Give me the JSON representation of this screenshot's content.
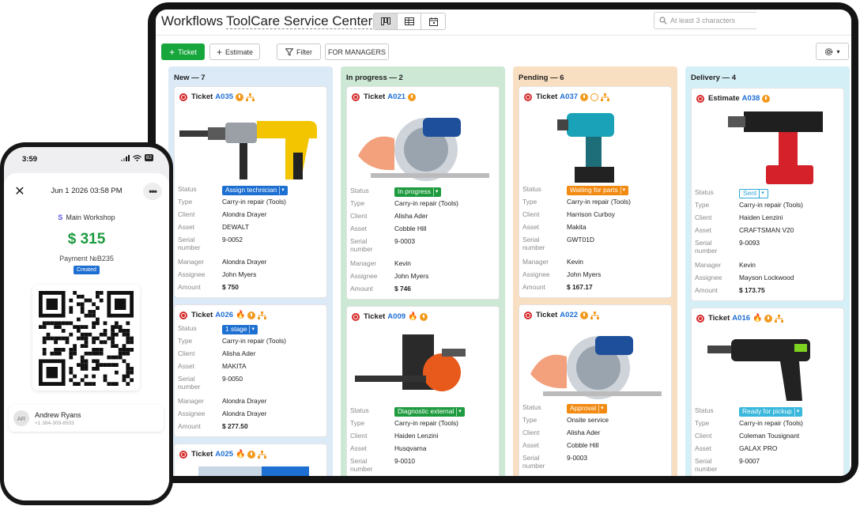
{
  "header": {
    "title": "Workflows",
    "org_name": "ToolCare Service Center",
    "search_placeholder": "At least 3 characters"
  },
  "toolbar": {
    "ticket_label": "Ticket",
    "estimate_label": "Estimate",
    "filter_label": "Filter",
    "managers_label": "FOR MANAGERS"
  },
  "field_labels": {
    "status": "Status",
    "type": "Type",
    "client": "Client",
    "asset": "Asset",
    "serial": "Serial number",
    "manager": "Manager",
    "assignee": "Assignee",
    "amount": "Amount"
  },
  "columns": {
    "new": {
      "title": "New — 7",
      "cards": [
        {
          "kind": "Ticket",
          "number": "A035",
          "status": "Assign technician",
          "type": "Carry-in repair (Tools)",
          "client": "Alondra Drayer",
          "asset": "DEWALT",
          "serial": "9-0052",
          "manager": "Alondra Drayer",
          "assignee": "John Myers",
          "amount": "$ 750"
        },
        {
          "kind": "Ticket",
          "number": "A026",
          "status": "1 stage",
          "type": "Carry-in repair (Tools)",
          "client": "Alisha Ader",
          "asset": "MAKITA",
          "serial": "9-0050",
          "manager": "Alondra Drayer",
          "assignee": "Alondra Drayer",
          "amount": "$ 277.50"
        },
        {
          "kind": "Ticket",
          "number": "A025"
        }
      ]
    },
    "progress": {
      "title": "In progress — 2",
      "cards": [
        {
          "kind": "Ticket",
          "number": "A021",
          "status": "In progress",
          "type": "Carry-in repair (Tools)",
          "client": "Alisha Ader",
          "asset": "Cobble Hill",
          "serial": "9-0003",
          "manager": "Kevin",
          "assignee": "John Myers",
          "amount": "$ 746"
        },
        {
          "kind": "Ticket",
          "number": "A009",
          "status": "Diagnostic external",
          "type": "Carry-in repair (Tools)",
          "client": "Haiden Lenzini",
          "asset": "Husqvarna",
          "serial": "9-0010"
        }
      ]
    },
    "pending": {
      "title": "Pending — 6",
      "cards": [
        {
          "kind": "Ticket",
          "number": "A037",
          "status": "Waiting for parts",
          "type": "Carry-in repair (Tools)",
          "client": "Harrison Curboy",
          "asset": "Makita",
          "serial": "GWT01D",
          "manager": "Kevin",
          "assignee": "John Myers",
          "amount": "$ 167.17"
        },
        {
          "kind": "Ticket",
          "number": "A022",
          "status": "Approval",
          "type": "Onsite service",
          "client": "Alisha Ader",
          "asset": "Cobble Hill",
          "serial": "9-0003"
        }
      ]
    },
    "delivery": {
      "title": "Delivery — 4",
      "cards": [
        {
          "kind": "Estimate",
          "number": "A038",
          "status": "Sent",
          "type": "Carry-in repair (Tools)",
          "client": "Haiden Lenzini",
          "asset": "CRAFTSMAN V20",
          "serial": "9-0093",
          "manager": "Kevin",
          "assignee": "Mayson Lockwood",
          "amount": "$ 173.75"
        },
        {
          "kind": "Ticket",
          "number": "A016",
          "status": "Ready for pickup",
          "type": "Carry-in repair (Tools)",
          "client": "Coleman Tousignant",
          "asset": "GALAX PRO",
          "serial": "9-0007"
        }
      ]
    }
  },
  "phone": {
    "time": "3:59",
    "battery": "82",
    "date": "Jun 1 2026 03:58 PM",
    "workshop": "Main Workshop",
    "amount": "$ 315",
    "payment_number": "Payment №B235",
    "status": "Created",
    "contact_name": "Andrew Ryans",
    "contact_phone": "+1 384-309-8503",
    "contact_initials": "AR"
  },
  "colors": {
    "primary_green": "#17a63c",
    "link_blue": "#1f6fd6",
    "new_col": "#dceaf8",
    "progress_col": "#cde8d5",
    "pending_col": "#f9dfc2",
    "delivery_col": "#d5eff6"
  }
}
